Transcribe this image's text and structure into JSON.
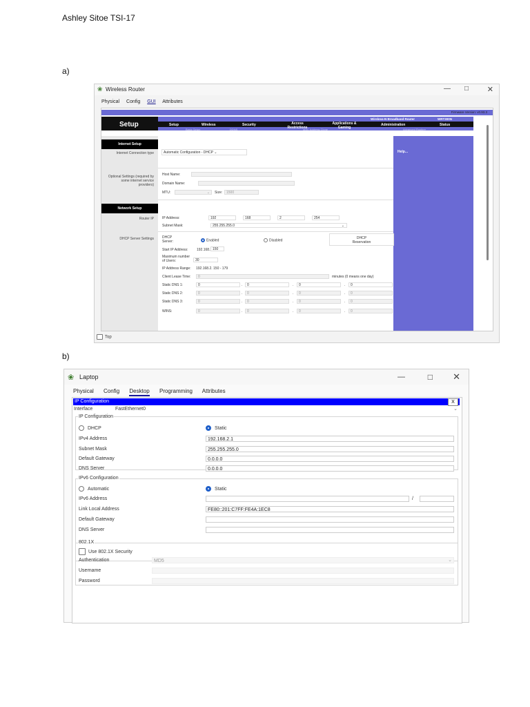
{
  "doc": {
    "title": "Ashley Sitoe TSI-17",
    "label_a": "a)",
    "label_b": "b)"
  },
  "router_window": {
    "title": "Wireless Router",
    "tabs": [
      "Physical",
      "Config",
      "GUI",
      "Attributes"
    ],
    "active_tab": "GUI",
    "firmware": "Firmware Version: v0.93.3",
    "product": "Wireless-N Broadband Router",
    "model": "WRT300N",
    "section": "Setup",
    "nav": [
      "Setup",
      "Wireless",
      "Security",
      "Access Restrictions",
      "Applications & Gaming",
      "Administration",
      "Status"
    ],
    "subnav": [
      "Basic Setup",
      "DDNS",
      "MAC Address Clone",
      "Advanced Routing"
    ],
    "internet_setup": {
      "header": "Internet Setup",
      "conn_label": "Internet Connection type",
      "conn_value": "Automatic Configuration - DHCP",
      "optional_label": "Optional Settings (required by some internet service providers)",
      "host_name": "Host Name:",
      "domain_name": "Domain Name:",
      "mtu": "MTU:",
      "size": "Size:",
      "size_value": "1500"
    },
    "network_setup": {
      "header": "Network Setup",
      "router_ip": "Router IP",
      "ip_label": "IP Address:",
      "ip": [
        "192",
        "168",
        "2",
        "254"
      ],
      "mask_label": "Subnet Mask:",
      "mask": "255.255.255.0",
      "dhcp_label": "DHCP Server Settings",
      "dhcp_server": "DHCP Server:",
      "enabled": "Enabled",
      "disabled": "Disabled",
      "reservation": "DHCP Reservation",
      "start_ip_label": "Start IP Address:",
      "start_ip_prefix": "192.168.2.",
      "start_ip": "150",
      "max_users_label": "Maximum number of Users:",
      "max_users": "30",
      "range_label": "IP Address Range:",
      "range": "192.168.2. 150 - 179",
      "lease_label": "Client Lease Time:",
      "lease": "0",
      "lease_note": "minutes (0 means one day)",
      "dns1": "Static DNS 1:",
      "dns2": "Static DNS 2:",
      "dns3": "Static DNS 3:",
      "wins": "WINS:",
      "zero": "0",
      "dot": "."
    },
    "help": "Help...",
    "top_checkbox": "Top"
  },
  "laptop_window": {
    "title": "Laptop",
    "tabs": [
      "Physical",
      "Config",
      "Desktop",
      "Programming",
      "Attributes"
    ],
    "active_tab": "Desktop",
    "ip_config_title": "IP Configuration",
    "close": "X",
    "interface_label": "Interface",
    "interface_value": "FastEthernet0",
    "ipv4_group": "IP Configuration",
    "dhcp": "DHCP",
    "static": "Static",
    "ipv4_label": "IPv4 Address",
    "ipv4": "192.168.2.1",
    "subnet_label": "Subnet Mask",
    "subnet": "255.255.255.0",
    "gateway_label": "Default Gateway",
    "gateway": "0.0.0.0",
    "dns_label": "DNS Server",
    "dns": "0.0.0.0",
    "ipv6_group": "IPv6 Configuration",
    "automatic": "Automatic",
    "ipv6_label": "IPv6 Address",
    "ipv6_slash": "/",
    "link_local_label": "Link Local Address",
    "link_local": "FE80::201:C7FF:FE4A:1EC8",
    "dot1x_group": "802.1X",
    "use_dot1x": "Use 802.1X Security",
    "auth_label": "Authentication",
    "auth_value": "MD5",
    "username_label": "Username",
    "password_label": "Password"
  }
}
